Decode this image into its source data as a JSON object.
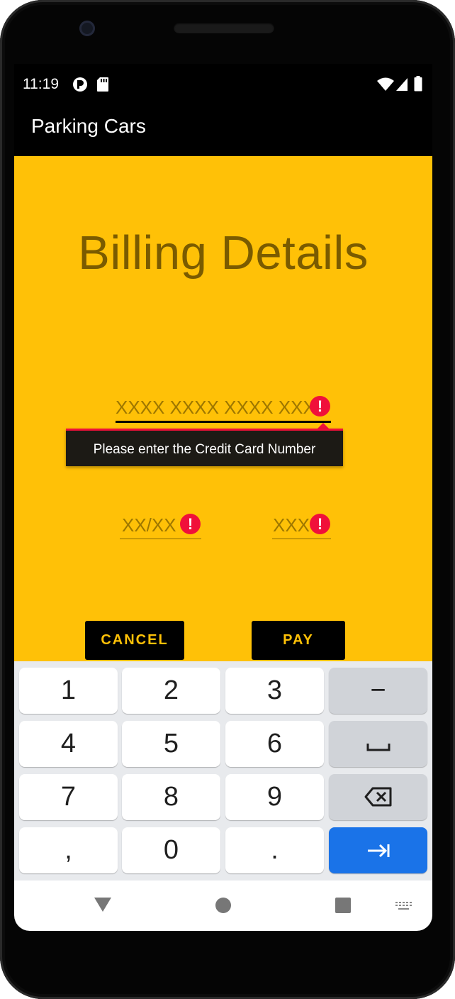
{
  "status_bar": {
    "time": "11:19",
    "icons_left": [
      "app-notification-icon",
      "sd-card-icon"
    ],
    "icons_right": [
      "wifi-icon",
      "signal-icon",
      "battery-icon"
    ]
  },
  "app_bar": {
    "title": "Parking Cars"
  },
  "form": {
    "heading": "Billing Details",
    "card_number": {
      "value": "",
      "placeholder": "XXXX XXXX XXXX XXX",
      "error": "Please enter the Credit Card Number"
    },
    "expiry": {
      "value": "",
      "placeholder": "XX/XX"
    },
    "cvv": {
      "value": "",
      "placeholder": "XXX"
    },
    "cancel_label": "CANCEL",
    "pay_label": "PAY"
  },
  "keyboard": {
    "keys": [
      "1",
      "2",
      "3",
      "−",
      "4",
      "5",
      "6",
      "␣",
      "7",
      "8",
      "9",
      "⌫",
      ",",
      "0",
      ".",
      "→|"
    ]
  },
  "nav_bar": {
    "icons": [
      "back-icon",
      "home-icon",
      "recents-icon",
      "keyboard-switch-icon"
    ]
  },
  "colors": {
    "accent": "#FFC107",
    "heading": "#7A5B00",
    "error": "#F0103A",
    "key_action": "#1A73E8"
  }
}
